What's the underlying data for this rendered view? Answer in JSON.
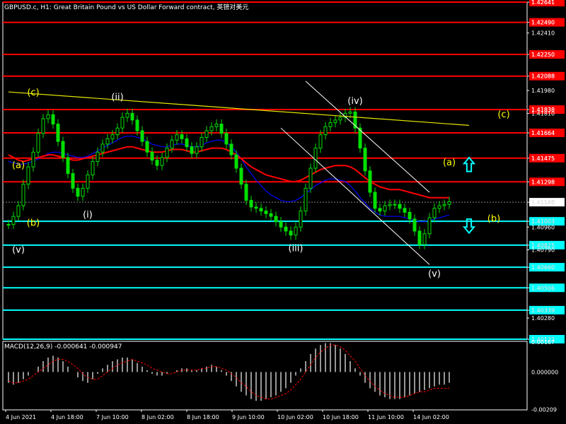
{
  "header": {
    "title": "GBPUSD.c, H1:  Great Britain Pound vs US Dollar Forward contract, 英镑对美元"
  },
  "colors": {
    "background": "#000000",
    "grid": "#ffffff",
    "candle": "#00e000",
    "red_level": "#ff0000",
    "cyan_level": "#00ffff",
    "trend": "#e6e600",
    "channel": "#ffffff",
    "ma_red": "#ff0000",
    "ma_blue": "#0000ff",
    "wave_white": "#ffffff",
    "wave_yellow": "#ffff00",
    "arrow": "#00ffff",
    "macd_hist": "#c8c8c8",
    "macd_signal": "#ff0000"
  },
  "chart_data": {
    "type": "candlestick",
    "symbol": "GBPUSD.c",
    "timeframe": "H1",
    "ylim": [
      1.40122,
      1.42641
    ],
    "ytick_labels": [
      "1.42641",
      "1.42490",
      "1.42410",
      "1.42250",
      "1.42088",
      "1.41980",
      "1.41838",
      "1.41810",
      "1.41664",
      "1.41475",
      "1.41298",
      "1.41146",
      "1.41003",
      "1.40960",
      "1.40825",
      "1.40790",
      "1.40660",
      "1.40506",
      "1.40339",
      "1.40280",
      "1.40122"
    ],
    "x_labels": [
      "4 Jun 2021",
      "4 Jun 18:00",
      "7 Jun 10:00",
      "8 Jun 02:00",
      "8 Jun 18:00",
      "9 Jun 10:00",
      "10 Jun 02:00",
      "10 Jun 18:00",
      "11 Jun 10:00",
      "14 Jun 02:00"
    ],
    "current_price": 1.41146,
    "close": [
      1.4098,
      1.4104,
      1.4112,
      1.4128,
      1.4141,
      1.4152,
      1.4166,
      1.4177,
      1.418,
      1.4173,
      1.416,
      1.4148,
      1.4136,
      1.4125,
      1.4119,
      1.4125,
      1.4135,
      1.4145,
      1.4152,
      1.4158,
      1.4162,
      1.4165,
      1.417,
      1.4178,
      1.4181,
      1.4176,
      1.4168,
      1.416,
      1.4152,
      1.4146,
      1.4142,
      1.4148,
      1.4155,
      1.4161,
      1.4165,
      1.4162,
      1.4156,
      1.4151,
      1.4156,
      1.4163,
      1.4168,
      1.4171,
      1.4173,
      1.4166,
      1.4158,
      1.415,
      1.414,
      1.4128,
      1.4116,
      1.4111,
      1.411,
      1.4108,
      1.4106,
      1.4104,
      1.41,
      1.4096,
      1.4093,
      1.409,
      1.4096,
      1.4108,
      1.4125,
      1.414,
      1.4155,
      1.4165,
      1.4171,
      1.4174,
      1.4176,
      1.4178,
      1.4181,
      1.4182,
      1.417,
      1.4155,
      1.4138,
      1.4122,
      1.411,
      1.4108,
      1.4112,
      1.4113,
      1.4113,
      1.411,
      1.4107,
      1.4102,
      1.4093,
      1.4083,
      1.4091,
      1.4103,
      1.411,
      1.4112,
      1.4113,
      1.4115
    ],
    "resistance_levels": [
      1.42641,
      1.4249,
      1.4225,
      1.42088,
      1.41838,
      1.41664,
      1.41475,
      1.41298
    ],
    "support_levels": [
      1.41003,
      1.40825,
      1.4066,
      1.40506,
      1.40339,
      1.40122
    ],
    "trendline": [
      [
        0,
        1.4197
      ],
      [
        93,
        1.4172
      ]
    ],
    "channel_upper": [
      [
        60,
        1.4205
      ],
      [
        85,
        1.4122
      ]
    ],
    "channel_lower": [
      [
        55,
        1.417
      ],
      [
        85,
        1.4068
      ]
    ],
    "ma_red": [
      1.415,
      1.4148,
      1.4146,
      1.4145,
      1.4146,
      1.4147,
      1.4148,
      1.4149,
      1.415,
      1.415,
      1.4149,
      1.4148,
      1.4147,
      1.4146,
      1.4146,
      1.4147,
      1.4148,
      1.4149,
      1.415,
      1.4151,
      1.4152,
      1.4153,
      1.4154,
      1.4155,
      1.4156,
      1.4156,
      1.4155,
      1.4154,
      1.4153,
      1.4152,
      1.4152,
      1.4152,
      1.4153,
      1.4154,
      1.4154,
      1.4154,
      1.4153,
      1.4152,
      1.4152,
      1.4153,
      1.4154,
      1.4155,
      1.4155,
      1.4155,
      1.4154,
      1.4152,
      1.415,
      1.4147,
      1.4144,
      1.4141,
      1.4139,
      1.4137,
      1.4135,
      1.4134,
      1.4133,
      1.4132,
      1.4131,
      1.413,
      1.413,
      1.4131,
      1.4133,
      1.4135,
      1.4137,
      1.4139,
      1.414,
      1.4141,
      1.4142,
      1.4142,
      1.4142,
      1.4141,
      1.4139,
      1.4136,
      1.4133,
      1.413,
      1.4128,
      1.4126,
      1.4125,
      1.4124,
      1.4124,
      1.4124,
      1.4123,
      1.4122,
      1.4121,
      1.412,
      1.4119,
      1.4118,
      1.4118,
      1.4118,
      1.4118,
      1.4118
    ],
    "ma_blue": [
      1.4145,
      1.4144,
      1.4143,
      1.4143,
      1.4144,
      1.4145,
      1.4147,
      1.4149,
      1.4151,
      1.4152,
      1.4152,
      1.4151,
      1.415,
      1.4149,
      1.4148,
      1.4148,
      1.4149,
      1.4151,
      1.4153,
      1.4155,
      1.4157,
      1.4159,
      1.4161,
      1.4163,
      1.4164,
      1.4164,
      1.4163,
      1.4162,
      1.416,
      1.4158,
      1.4157,
      1.4156,
      1.4156,
      1.4157,
      1.4158,
      1.4158,
      1.4157,
      1.4156,
      1.4156,
      1.4157,
      1.4159,
      1.416,
      1.4161,
      1.4161,
      1.4159,
      1.4156,
      1.4152,
      1.4147,
      1.4141,
      1.4136,
      1.4131,
      1.4127,
      1.4123,
      1.412,
      1.4118,
      1.4116,
      1.4115,
      1.4115,
      1.4116,
      1.4118,
      1.4121,
      1.4124,
      1.4127,
      1.4129,
      1.4131,
      1.4132,
      1.4132,
      1.4131,
      1.413,
      1.4127,
      1.4123,
      1.4118,
      1.4114,
      1.411,
      1.4107,
      1.4105,
      1.4104,
      1.4104,
      1.4104,
      1.4104,
      1.4103,
      1.4102,
      1.4101,
      1.41,
      1.41,
      1.4101,
      1.4102,
      1.4103,
      1.4104,
      1.4105
    ],
    "wave_labels": [
      {
        "text": "(c)",
        "i": 5,
        "price": 1.41945,
        "color": "yellow"
      },
      {
        "text": "(ii)",
        "i": 22,
        "price": 1.4191,
        "color": "white"
      },
      {
        "text": "(iv)",
        "i": 70,
        "price": 1.4188,
        "color": "white"
      },
      {
        "text": "(c)",
        "i": 100,
        "price": 1.4178,
        "color": "yellow"
      },
      {
        "text": "(a)",
        "i": 2,
        "price": 1.414,
        "color": "yellow"
      },
      {
        "text": "(a)",
        "i": 89,
        "price": 1.4142,
        "color": "yellow"
      },
      {
        "text": "(i)",
        "i": 16,
        "price": 1.4103,
        "color": "white"
      },
      {
        "text": "(b)",
        "i": 5,
        "price": 1.4097,
        "color": "yellow"
      },
      {
        "text": "(b)",
        "i": 98,
        "price": 1.41,
        "color": "yellow"
      },
      {
        "text": "(iii)",
        "i": 58,
        "price": 1.4078,
        "color": "white"
      },
      {
        "text": "(v)",
        "i": 2,
        "price": 1.4077,
        "color": "white"
      },
      {
        "text": "(v)",
        "i": 86,
        "price": 1.4059,
        "color": "white"
      }
    ],
    "arrows": [
      {
        "dir": "up",
        "i": 93,
        "price": 1.4142
      },
      {
        "dir": "down",
        "i": 93,
        "price": 1.40975
      }
    ],
    "macd": {
      "label": "MACD(12,26,9) -0.000641 -0.000947",
      "ylim": [
        -0.0021,
        0.0017
      ],
      "ytick_labels": [
        "0.00167",
        "0.000000",
        "-0.00209"
      ],
      "histogram": [
        -0.0006,
        -0.0007,
        -0.0006,
        -0.0004,
        -0.0002,
        0.0,
        0.0003,
        0.0006,
        0.0008,
        0.0009,
        0.0008,
        0.0006,
        0.0003,
        0.0,
        -0.0003,
        -0.0005,
        -0.0006,
        -0.0004,
        -0.0001,
        0.0002,
        0.0004,
        0.0006,
        0.0007,
        0.0008,
        0.0008,
        0.0007,
        0.0005,
        0.0003,
        0.0001,
        -0.0001,
        -0.0002,
        -0.0002,
        -0.0001,
        0.0,
        0.0001,
        0.0002,
        0.0002,
        0.0001,
        0.0001,
        0.0002,
        0.0003,
        0.0004,
        0.0003,
        0.0001,
        -0.0002,
        -0.0005,
        -0.0008,
        -0.0011,
        -0.0013,
        -0.0015,
        -0.0016,
        -0.0016,
        -0.0015,
        -0.0014,
        -0.0013,
        -0.0011,
        -0.0009,
        -0.0006,
        -0.0002,
        0.0002,
        0.0006,
        0.001,
        0.0013,
        0.0015,
        0.0016,
        0.0016,
        0.0015,
        0.0013,
        0.001,
        0.0006,
        0.0002,
        -0.0002,
        -0.0006,
        -0.0009,
        -0.0011,
        -0.0013,
        -0.0014,
        -0.0015,
        -0.0015,
        -0.0015,
        -0.0014,
        -0.0013,
        -0.0012,
        -0.0011,
        -0.001,
        -0.0009,
        -0.0008,
        -0.0007,
        -0.0007,
        -0.0006
      ],
      "signal": [
        -0.0005,
        -0.0006,
        -0.0006,
        -0.0005,
        -0.0004,
        -0.0002,
        0.0,
        0.0002,
        0.0004,
        0.0006,
        0.0007,
        0.0007,
        0.0006,
        0.0004,
        0.0002,
        -0.0001,
        -0.0003,
        -0.0004,
        -0.0004,
        -0.0002,
        0.0,
        0.0002,
        0.0004,
        0.0005,
        0.0006,
        0.0007,
        0.0006,
        0.0005,
        0.0004,
        0.0002,
        0.0001,
        0.0,
        -0.0001,
        -0.0001,
        0.0,
        0.0001,
        0.0001,
        0.0001,
        0.0001,
        0.0002,
        0.0002,
        0.0003,
        0.0003,
        0.0002,
        0.0001,
        -0.0001,
        -0.0003,
        -0.0006,
        -0.0008,
        -0.0011,
        -0.0013,
        -0.0014,
        -0.0015,
        -0.0015,
        -0.0014,
        -0.0013,
        -0.0012,
        -0.001,
        -0.0007,
        -0.0004,
        0.0,
        0.0004,
        0.0008,
        0.0011,
        0.0013,
        0.0015,
        0.0015,
        0.0014,
        0.0012,
        0.0009,
        0.0006,
        0.0002,
        -0.0002,
        -0.0005,
        -0.0008,
        -0.001,
        -0.0012,
        -0.0013,
        -0.0014,
        -0.0014,
        -0.0014,
        -0.0013,
        -0.0012,
        -0.0011,
        -0.0011,
        -0.001,
        -0.0009,
        -0.0009,
        -0.0009,
        -0.0009
      ]
    }
  }
}
